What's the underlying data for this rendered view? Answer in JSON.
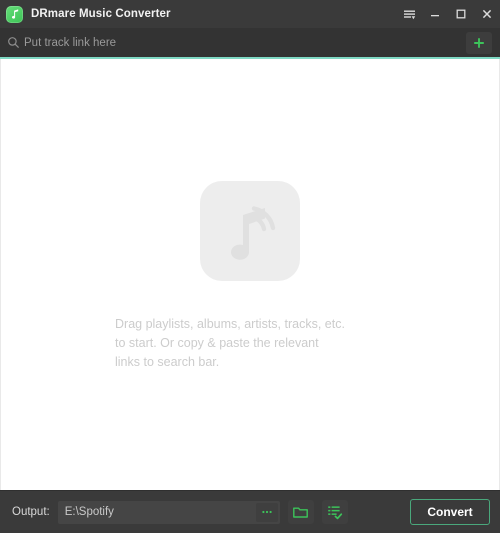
{
  "window": {
    "title": "DRmare Music Converter",
    "app_icon": "music-note-app-icon",
    "controls": {
      "menu": "menu-icon",
      "minimize": "minimize-icon",
      "maximize": "maximize-icon",
      "close": "close-icon"
    }
  },
  "search": {
    "icon": "search-icon",
    "placeholder": "Put track link here",
    "value": "",
    "add_button": "plus-icon"
  },
  "content": {
    "graphic": "music-note-broadcast-icon",
    "message": "Drag playlists, albums, artists, tracks, etc.\nto start. Or copy & paste the relevant\nlinks to search bar."
  },
  "footer": {
    "output_label": "Output:",
    "output_path": "E:\\Spotify",
    "browse_icon": "ellipsis-icon",
    "open_folder_icon": "folder-icon",
    "history_icon": "list-check-icon",
    "convert_label": "Convert"
  },
  "colors": {
    "titlebar": "#3a3a3a",
    "searchbar": "#333333",
    "accent_line": "#7fd9c4",
    "green": "#3cc35a",
    "content_bg": "#ffffff",
    "placeholder_gray": "#cccccc"
  }
}
